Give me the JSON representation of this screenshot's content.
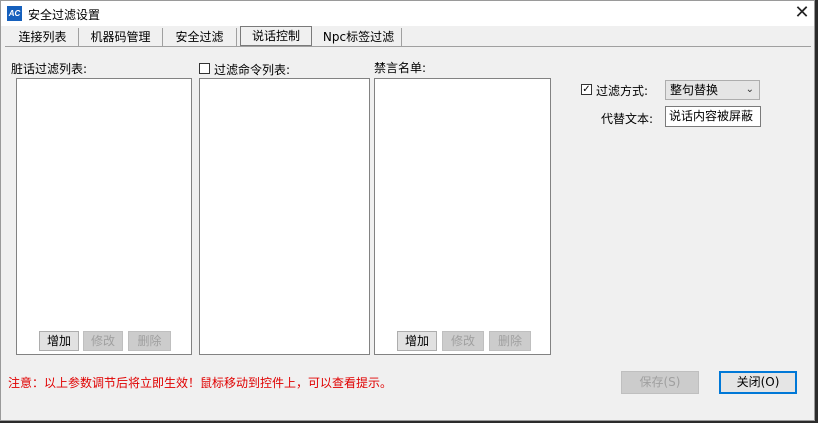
{
  "window": {
    "title": "安全过滤设置",
    "app_icon_text": "AC",
    "close_glyph": "✕"
  },
  "tabs": [
    {
      "label": "连接列表",
      "active": false
    },
    {
      "label": "机器码管理",
      "active": false
    },
    {
      "label": "安全过滤",
      "active": false
    },
    {
      "label": "说话控制",
      "active": true
    },
    {
      "label": "Npc标签过滤",
      "active": false
    }
  ],
  "dirty_words": {
    "label": "脏话过滤列表:",
    "add": "增加",
    "edit": "修改",
    "delete": "删除"
  },
  "filter_commands": {
    "label": "过滤命令列表:",
    "checked": false
  },
  "ban_list": {
    "label": "禁言名单:",
    "add": "增加",
    "edit": "修改",
    "delete": "删除"
  },
  "filter_mode": {
    "checkbox_label": "过滤方式:",
    "checked": true,
    "check_glyph": "✓",
    "selected": "整句替换",
    "replace_label": "代替文本:",
    "replace_value": "说话内容被屏蔽"
  },
  "notice": "注意：以上参数调节后将立即生效！鼠标移动到控件上，可以查看提示。",
  "footer": {
    "save": "保存(S)",
    "close": "关闭(O)"
  }
}
